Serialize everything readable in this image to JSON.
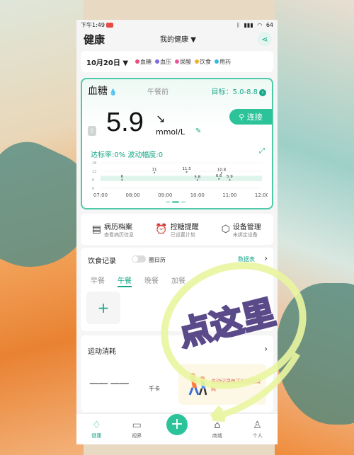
{
  "status_bar": {
    "time": "下午1:49",
    "battery": "64"
  },
  "header": {
    "title": "健康",
    "switch_label": "我的健康"
  },
  "date_bar": {
    "date": "10月20日",
    "legend": [
      {
        "label": "血糖",
        "color": "#e8507a"
      },
      {
        "label": "血压",
        "color": "#7b6ae0"
      },
      {
        "label": "尿酸",
        "color": "#e85a9a"
      },
      {
        "label": "饮食",
        "color": "#f0b030"
      },
      {
        "label": "用药",
        "color": "#36b6e0"
      }
    ]
  },
  "glucose": {
    "title": "血糖",
    "period": "午餐前",
    "target": "目标：5.0-8.8",
    "value": "5.9",
    "trend": "↘",
    "unit": "mmol/L",
    "connect_label": "连接",
    "rate_text": "达标率:0%  波动幅度:0"
  },
  "chart_data": {
    "type": "scatter",
    "x": [
      "07:00",
      "08:00",
      "09:00",
      "10:00",
      "11:00",
      "12:00"
    ],
    "y_ticks": [
      18,
      12,
      6,
      0
    ],
    "points": [
      {
        "x": "07:40",
        "y": 6
      },
      {
        "x": "08:40",
        "y": 11
      },
      {
        "x": "09:40",
        "y": 11.5
      },
      {
        "x": "10:00",
        "y": 5.8
      },
      {
        "x": "10:40",
        "y": 6.6
      },
      {
        "x": "10:45",
        "y": 10.8
      },
      {
        "x": "11:00",
        "y": 5.9
      }
    ],
    "point_labels": [
      "6",
      "11",
      "11.5",
      "5.8",
      "6.6",
      "10.8",
      "5.9"
    ],
    "target_band": [
      5.0,
      8.8
    ],
    "ylim": [
      0,
      18
    ]
  },
  "services": [
    {
      "icon": "medical-record-icon",
      "glyph": "▤",
      "title": "病历档案",
      "desc": "查看病历信息"
    },
    {
      "icon": "alarm-clock-icon",
      "glyph": "⏰",
      "title": "控糖提醒",
      "desc": "已设置计划"
    },
    {
      "icon": "device-box-icon",
      "glyph": "⬡",
      "title": "设备管理",
      "desc": "未绑定设备"
    }
  ],
  "diet": {
    "title": "饮食记录",
    "toggle_label": "圈日历",
    "data_table": "数据表",
    "tabs": [
      "早餐",
      "午餐",
      "晚餐",
      "加餐"
    ],
    "active_tab": 1
  },
  "sport": {
    "title": "运动消耗",
    "kcal": "——  ——",
    "unit": "千卡",
    "banner": "自动记录每天的运动消耗"
  },
  "tabbar": [
    {
      "label": "健康",
      "glyph": "♢"
    },
    {
      "label": "视界",
      "glyph": "▭"
    },
    {
      "label": "",
      "glyph": "+"
    },
    {
      "label": "商城",
      "glyph": "⌂"
    },
    {
      "label": "个人",
      "glyph": "♙"
    }
  ],
  "overlay_text": "点这里"
}
